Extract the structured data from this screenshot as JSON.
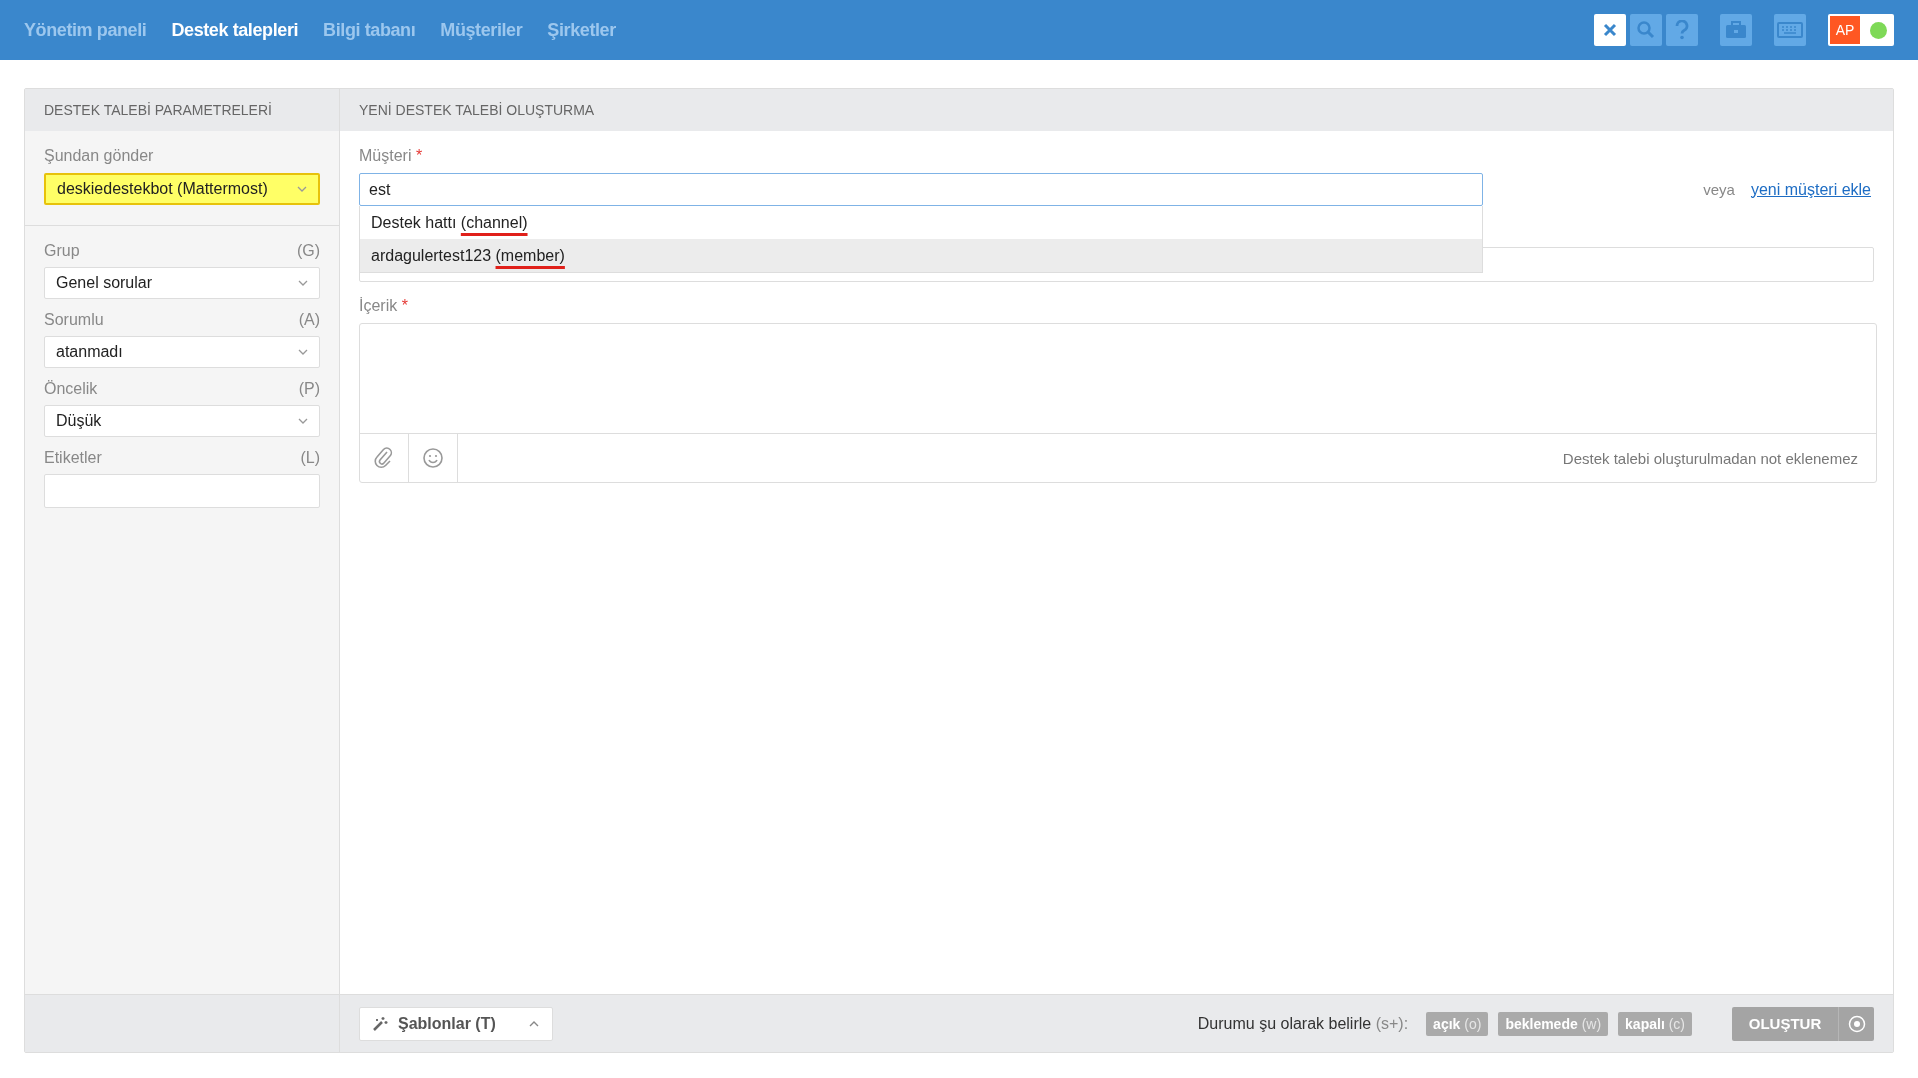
{
  "nav": {
    "items": [
      {
        "label": "Yönetim paneli",
        "selected": false
      },
      {
        "label": "Destek talepleri",
        "selected": true
      },
      {
        "label": "Bilgi tabanı",
        "selected": false
      },
      {
        "label": "Müşteriler",
        "selected": false
      },
      {
        "label": "Şirketler",
        "selected": false
      }
    ],
    "avatar": "AP",
    "online": true
  },
  "sidebar": {
    "title": "DESTEK TALEBİ PARAMETRELERİ",
    "send_from": {
      "label": "Şundan gönder",
      "value": "deskiedestekbot (Mattermost)",
      "highlighted": true
    },
    "fields": [
      {
        "kind": "select",
        "label": "Grup",
        "shortcut": "(G)",
        "value": "Genel sorular"
      },
      {
        "kind": "select",
        "label": "Sorumlu",
        "shortcut": "(A)",
        "value": "atanmadı"
      },
      {
        "kind": "select",
        "label": "Öncelik",
        "shortcut": "(P)",
        "value": "Düşük"
      },
      {
        "kind": "text",
        "label": "Etiketler",
        "shortcut": "(L)"
      }
    ]
  },
  "main": {
    "title": "YENİ DESTEK TALEBİ OLUŞTURMA",
    "customer": {
      "label": "Müşteri",
      "required_mark": "*",
      "value": "est",
      "or": "veya",
      "add_link": "yeni müşteri ekle"
    },
    "suggestions": [
      {
        "name": "Destek hattı",
        "tag": "(channel)",
        "underlined": true,
        "selected": false
      },
      {
        "name": "ardagulertest123",
        "tag": "(member)",
        "underlined": true,
        "selected": true
      }
    ],
    "content": {
      "label": "İçerik",
      "required_mark": "*",
      "note": "Destek talebi oluşturulmadan not eklenemez"
    }
  },
  "footer": {
    "templates": "Şablonlar (T)",
    "status_label": "Durumu şu olarak belirle",
    "status_shortcut": "(s+):",
    "statuses": [
      {
        "label": "açık",
        "key": "(o)"
      },
      {
        "label": "beklemede",
        "key": "(w)"
      },
      {
        "label": "kapalı",
        "key": "(c)"
      }
    ],
    "create": "OLUŞTUR",
    "create_disabled": true
  }
}
